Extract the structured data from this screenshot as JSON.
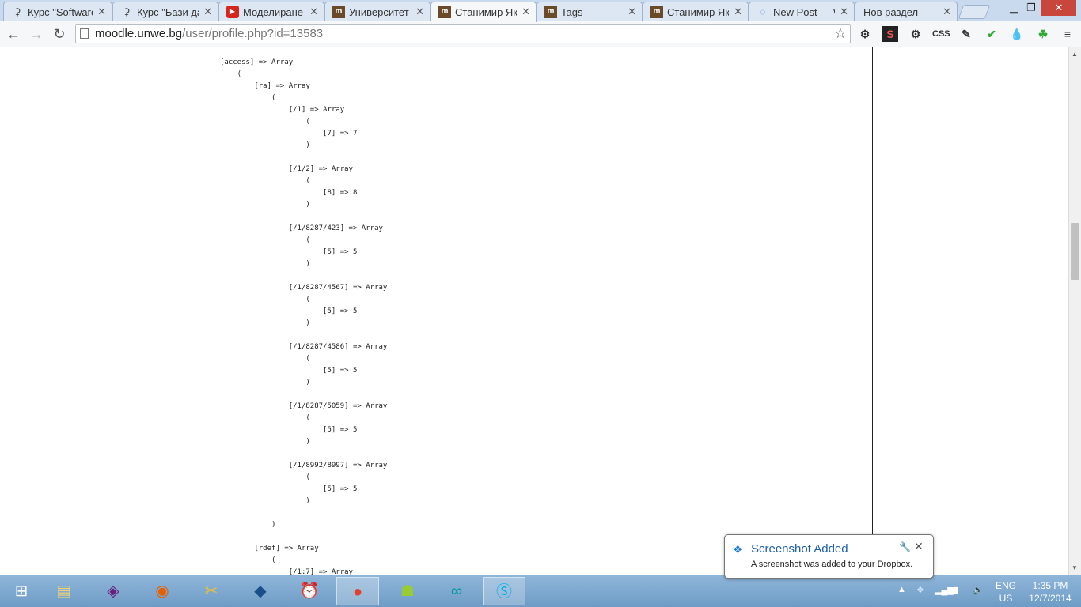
{
  "browser": {
    "tabs": [
      {
        "title": "Курс \"Software",
        "icon": "moodle-hat-icon"
      },
      {
        "title": "Курс \"Бази дан",
        "icon": "moodle-hat-icon"
      },
      {
        "title": "Моделиране н",
        "icon": "youtube-icon"
      },
      {
        "title": "Университет за",
        "icon": "moodle-m-icon"
      },
      {
        "title": "Станимир Яки",
        "icon": "moodle-m-icon",
        "active": true
      },
      {
        "title": "Tags",
        "icon": "moodle-m-icon"
      },
      {
        "title": "Станимир Яки",
        "icon": "moodle-m-icon"
      },
      {
        "title": "New Post — W",
        "icon": "loading-spinner-icon"
      },
      {
        "title": "Нов раздел",
        "icon": ""
      }
    ],
    "url_host": "moodle.unwe.bg",
    "url_path": "/user/profile.php?id=13583",
    "css_ext_label": "CSS"
  },
  "dump_lines": [
    "[access] => Array",
    "    (",
    "        [ra] => Array",
    "            (",
    "                [/1] => Array",
    "                    (",
    "                        [7] => 7",
    "                    )",
    "",
    "                [/1/2] => Array",
    "                    (",
    "                        [8] => 8",
    "                    )",
    "",
    "                [/1/8287/423] => Array",
    "                    (",
    "                        [5] => 5",
    "                    )",
    "",
    "                [/1/8287/4567] => Array",
    "                    (",
    "                        [5] => 5",
    "                    )",
    "",
    "                [/1/8287/4586] => Array",
    "                    (",
    "                        [5] => 5",
    "                    )",
    "",
    "                [/1/8287/5059] => Array",
    "                    (",
    "                        [5] => 5",
    "                    )",
    "",
    "                [/1/8992/8997] => Array",
    "                    (",
    "                        [5] => 5",
    "                    )",
    "",
    "            )",
    "",
    "        [rdef] => Array",
    "            (",
    "                [/1:7] => Array"
  ],
  "notification": {
    "title": "Screenshot Added",
    "message": "A screenshot was added to your Dropbox."
  },
  "taskbar": {
    "lang_1": "ENG",
    "lang_2": "US",
    "time": "1:35 PM",
    "date": "12/7/2014"
  }
}
